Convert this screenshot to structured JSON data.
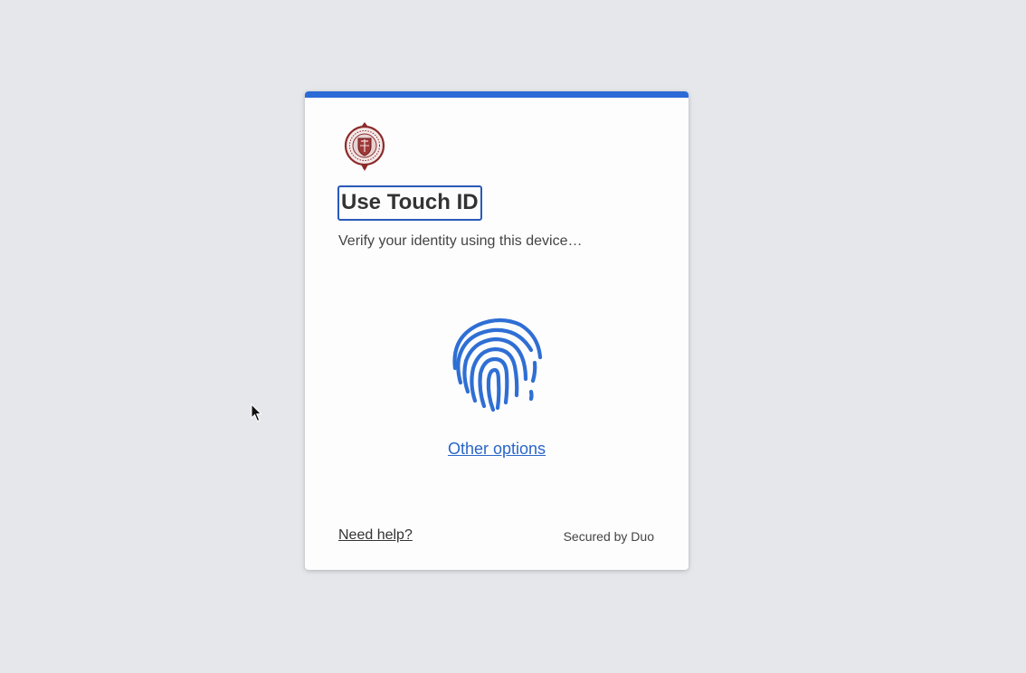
{
  "prompt": {
    "title": "Use Touch ID",
    "subtitle": "Verify your identity using this device…",
    "other_options_label": "Other options",
    "need_help_label": "Need help?",
    "secured_by_label": "Secured by Duo"
  },
  "icons": {
    "logo": "university-seal-icon",
    "fingerprint": "fingerprint-icon",
    "cursor": "mouse-pointer-icon"
  },
  "colors": {
    "accent": "#2c6ad6",
    "fingerprint": "#2f6fd4",
    "link": "#2a66c8",
    "seal": "#8c2a2a",
    "background": "#e6e7eb"
  }
}
